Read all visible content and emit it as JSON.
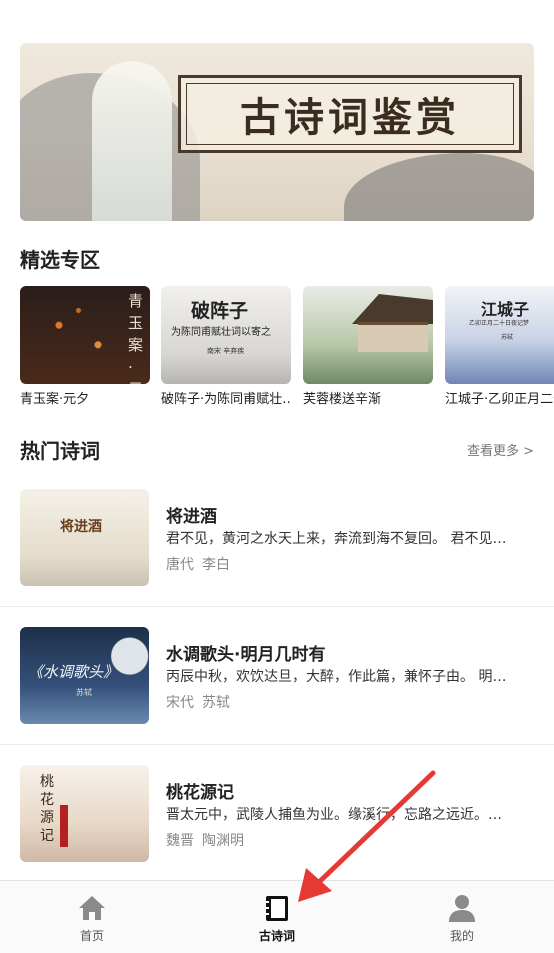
{
  "banner": {
    "title": "古诗词鉴赏"
  },
  "featured": {
    "heading": "精选专区",
    "items": [
      {
        "label": "青玉案·元夕",
        "thumb_text": "青玉案·元"
      },
      {
        "label": "破阵子·为陈同甫赋壮…",
        "thumb_title": "破阵子",
        "thumb_sub": "为陈同甫赋壮词以寄之",
        "thumb_author": "南宋 辛弃疾"
      },
      {
        "label": "芙蓉楼送辛渐"
      },
      {
        "label": "江城子·乙卯正月二十",
        "thumb_title": "江城子",
        "thumb_sub": "乙卯正月二十日夜记梦",
        "thumb_author": "苏轼"
      }
    ]
  },
  "hot": {
    "heading": "热门诗词",
    "more": "查看更多 >",
    "poems": [
      {
        "title": "将进酒",
        "excerpt": "君不见，黄河之水天上来，奔流到海不复回。 君不见…",
        "dynasty": "唐代",
        "author": "李白",
        "thumb_text": "将进酒"
      },
      {
        "title": "水调歌头·明月几时有",
        "excerpt": "丙辰中秋，欢饮达旦，大醉，作此篇，兼怀子由。 明…",
        "dynasty": "宋代",
        "author": "苏轼",
        "thumb_text": "《水调歌头》",
        "thumb_small": "苏轼"
      },
      {
        "title": "桃花源记",
        "excerpt": "晋太元中，武陵人捕鱼为业。缘溪行，忘路之远近。…",
        "dynasty": "魏晋",
        "author": "陶渊明",
        "thumb_text": "桃花源记"
      }
    ]
  },
  "tabbar": {
    "tabs": [
      {
        "label": "首页",
        "icon": "home-icon"
      },
      {
        "label": "古诗词",
        "icon": "book-icon",
        "active": true
      },
      {
        "label": "我的",
        "icon": "user-icon"
      }
    ]
  },
  "colors": {
    "active_tab": "#111111",
    "inactive_tab_icon": "#8a8a8a",
    "annotation_arrow": "#e53935"
  }
}
